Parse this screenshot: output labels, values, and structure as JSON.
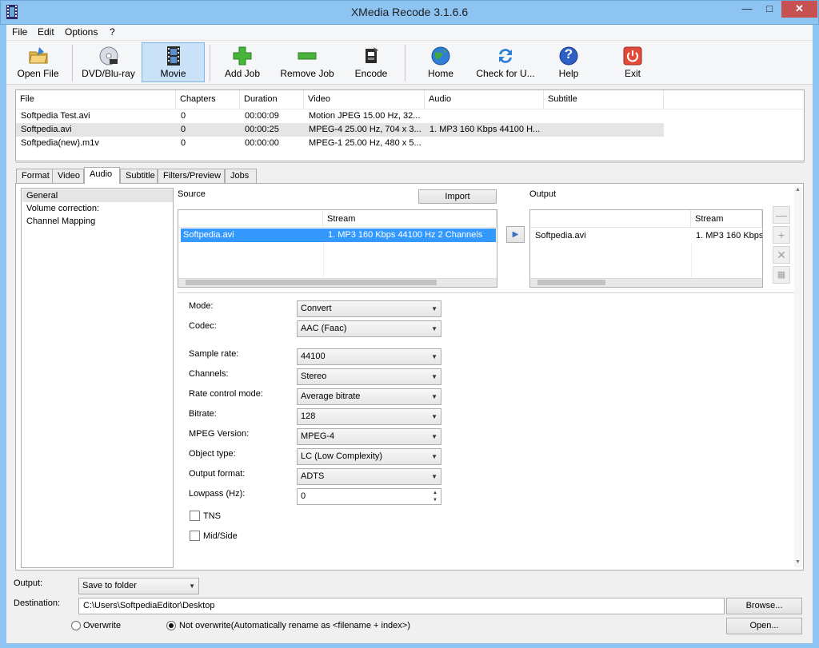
{
  "window": {
    "title": "XMedia Recode 3.1.6.6",
    "minimize": "—",
    "maximize": "□",
    "close": "✕"
  },
  "menu": [
    "File",
    "Edit",
    "Options",
    "?"
  ],
  "toolbar": {
    "open_file": "Open File",
    "dvd_bluray": "DVD/Blu-ray",
    "movie": "Movie",
    "add_job": "Add Job",
    "remove_job": "Remove Job",
    "encode": "Encode",
    "home": "Home",
    "check_updates": "Check for U...",
    "help": "Help",
    "exit": "Exit",
    "help_glyph": "?"
  },
  "file_list": {
    "columns": [
      "File",
      "Chapters",
      "Duration",
      "Video",
      "Audio",
      "Subtitle"
    ],
    "rows": [
      [
        "Softpedia Test.avi",
        "0",
        "00:00:09",
        "Motion JPEG 15.00 Hz, 32...",
        "",
        ""
      ],
      [
        "Softpedia.avi",
        "0",
        "00:00:25",
        "MPEG-4 25.00 Hz, 704 x 3...",
        "1. MP3 160 Kbps 44100 H...",
        ""
      ],
      [
        "Softpedia(new).m1v",
        "0",
        "00:00:00",
        "MPEG-1 25.00 Hz, 480 x 5...",
        "",
        ""
      ]
    ]
  },
  "tabs": [
    "Format",
    "Video",
    "Audio",
    "Subtitle",
    "Filters/Preview",
    "Jobs"
  ],
  "active_tab": "Audio",
  "left_nav": [
    "General",
    "Volume correction:",
    "Channel Mapping"
  ],
  "source": {
    "label": "Source",
    "import_button": "Import",
    "stream_header": "Stream",
    "row": [
      "Softpedia.avi",
      "1. MP3 160 Kbps 44100 Hz 2 Channels"
    ]
  },
  "output_pane": {
    "label": "Output",
    "stream_header": "Stream",
    "row": [
      "Softpedia.avi",
      "1. MP3 160 Kbps"
    ]
  },
  "form": {
    "mode": {
      "label": "Mode:",
      "value": "Convert"
    },
    "codec": {
      "label": "Codec:",
      "value": "AAC (Faac)"
    },
    "sample_rate": {
      "label": "Sample rate:",
      "value": "44100"
    },
    "channels": {
      "label": "Channels:",
      "value": "Stereo"
    },
    "rate_control": {
      "label": "Rate control mode:",
      "value": "Average bitrate"
    },
    "bitrate": {
      "label": "Bitrate:",
      "value": "128"
    },
    "mpeg_version": {
      "label": "MPEG Version:",
      "value": "MPEG-4"
    },
    "object_type": {
      "label": "Object type:",
      "value": "LC (Low Complexity)"
    },
    "output_format": {
      "label": "Output format:",
      "value": "ADTS"
    },
    "lowpass": {
      "label": "Lowpass (Hz):",
      "value": "0"
    },
    "tns": "TNS",
    "mid_side": "Mid/Side"
  },
  "bottom": {
    "output_label": "Output:",
    "output_value": "Save to folder",
    "destination_label": "Destination:",
    "destination_value": "C:\\Users\\SoftpediaEditor\\Desktop",
    "browse": "Browse...",
    "open": "Open...",
    "overwrite": "Overwrite",
    "not_overwrite": "Not overwrite(Automatically rename as <filename + index>)"
  }
}
